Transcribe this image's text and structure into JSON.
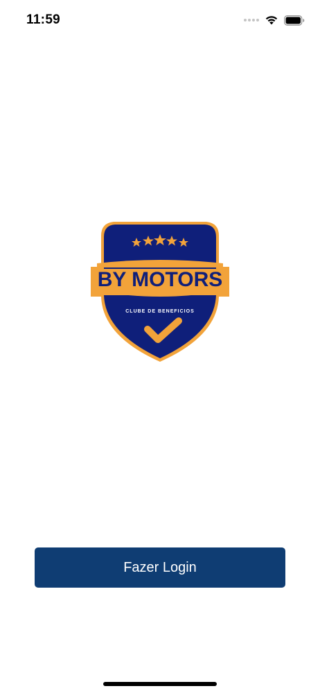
{
  "status_bar": {
    "time": "11:59",
    "signal_icon": "cellular-dots-icon",
    "wifi_icon": "wifi-icon",
    "battery_icon": "battery-icon"
  },
  "logo": {
    "brand_name": "BY MOTORS",
    "tagline": "CLUBE DE BENEFICIOS",
    "colors": {
      "navy": "#0f1f7a",
      "gold": "#f2a33a"
    }
  },
  "login": {
    "label": "Fazer Login",
    "color": "#0f3d73"
  }
}
